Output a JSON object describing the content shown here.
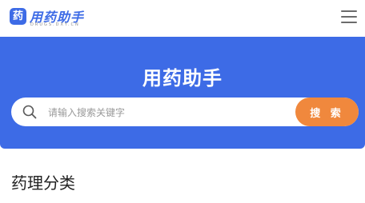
{
  "header": {
    "logo_icon_text": "药",
    "logo_title": "用药助手",
    "logo_subtitle": "DRUGS.DXY.CN",
    "menu_icon": "hamburger-menu-icon"
  },
  "banner": {
    "title": "用药助手",
    "search": {
      "placeholder": "请输入搜索关键字",
      "value": "",
      "button_label": "搜 索",
      "icon": "search-icon"
    }
  },
  "main": {
    "section_title": "药理分类"
  },
  "colors": {
    "primary": "#3d6be6",
    "accent": "#f0883d",
    "background": "#ffffff"
  }
}
